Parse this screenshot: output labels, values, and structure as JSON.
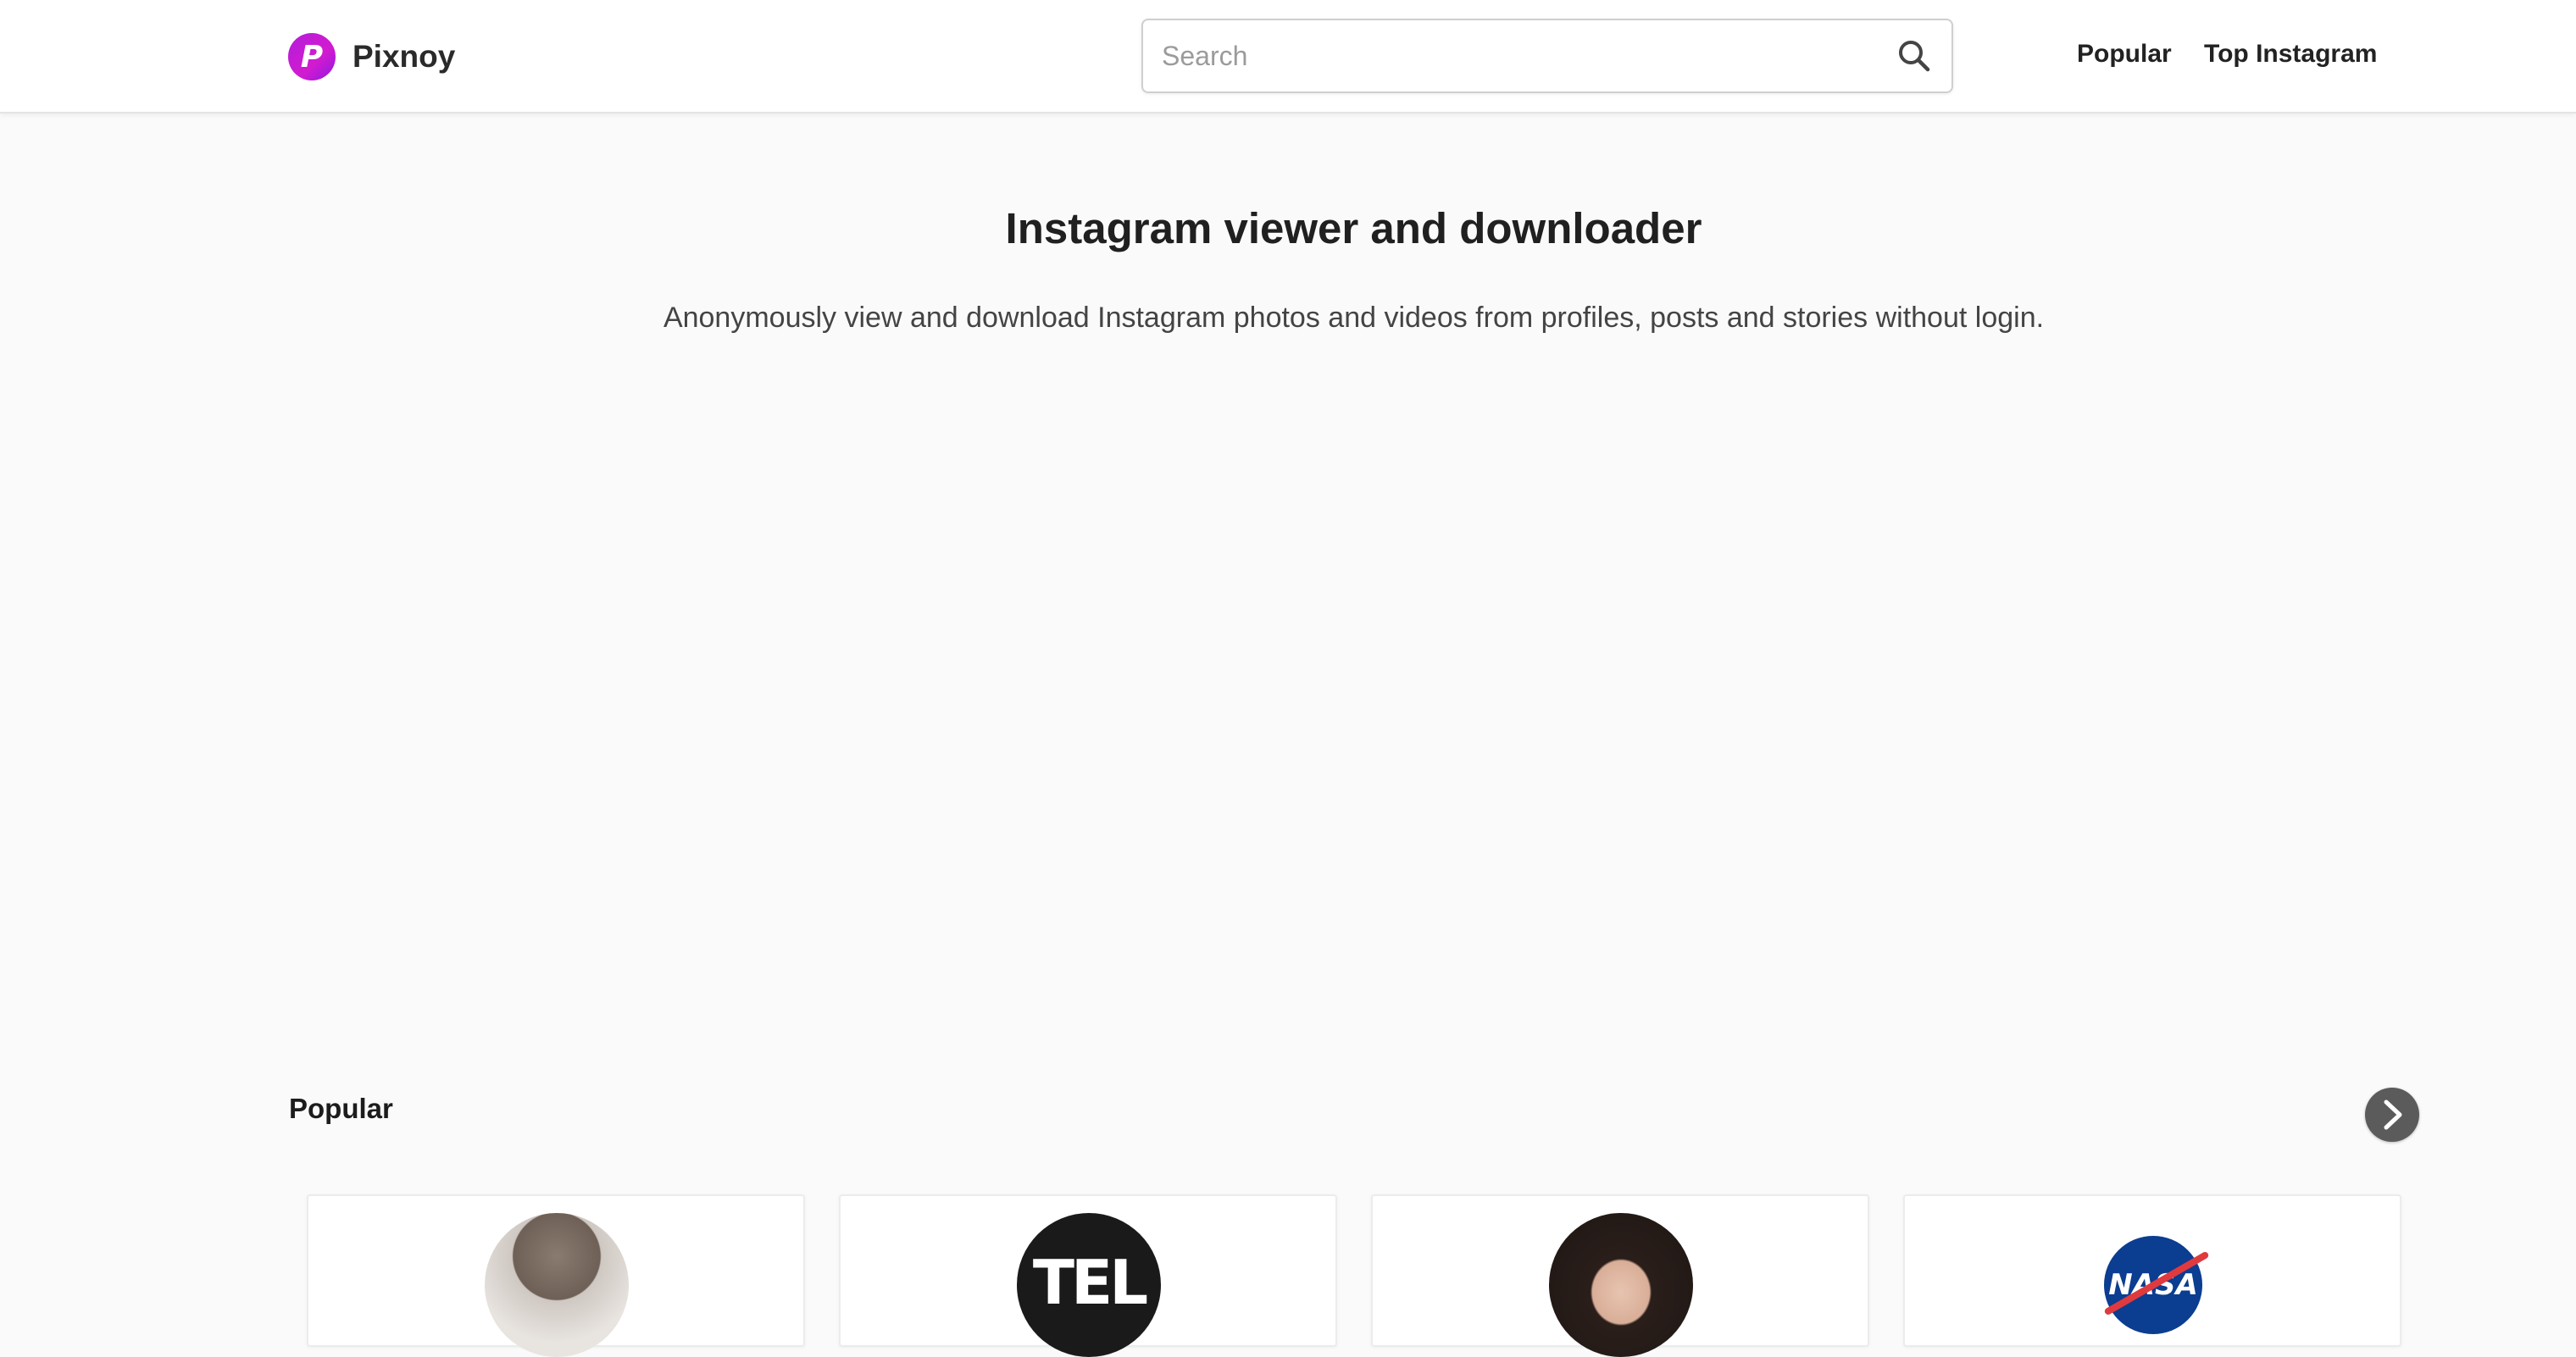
{
  "header": {
    "brand": {
      "mark": "P",
      "name": "Pixnoy"
    },
    "search": {
      "placeholder": "Search"
    },
    "nav": {
      "popular": "Popular",
      "top_instagram": "Top Instagram"
    }
  },
  "hero": {
    "title": "Instagram viewer and downloader",
    "subtitle": "Anonymously view and download Instagram photos and videos from profiles, posts and stories without login."
  },
  "popular": {
    "title": "Popular",
    "cards": [
      {
        "avatar": "profile-photo-man"
      },
      {
        "avatar": "tel-logo",
        "logo_text": "TEL"
      },
      {
        "avatar": "profile-photo-woman"
      },
      {
        "avatar": "nasa-logo",
        "logo_text": "NASA"
      }
    ]
  },
  "colors": {
    "brand": "#b31dd9",
    "page_background": "#fafafa",
    "header_background": "#ffffff",
    "carousel_button": "#5b5b5b"
  },
  "icons": [
    "logo-icon",
    "search-icon",
    "chevron-right-icon"
  ]
}
